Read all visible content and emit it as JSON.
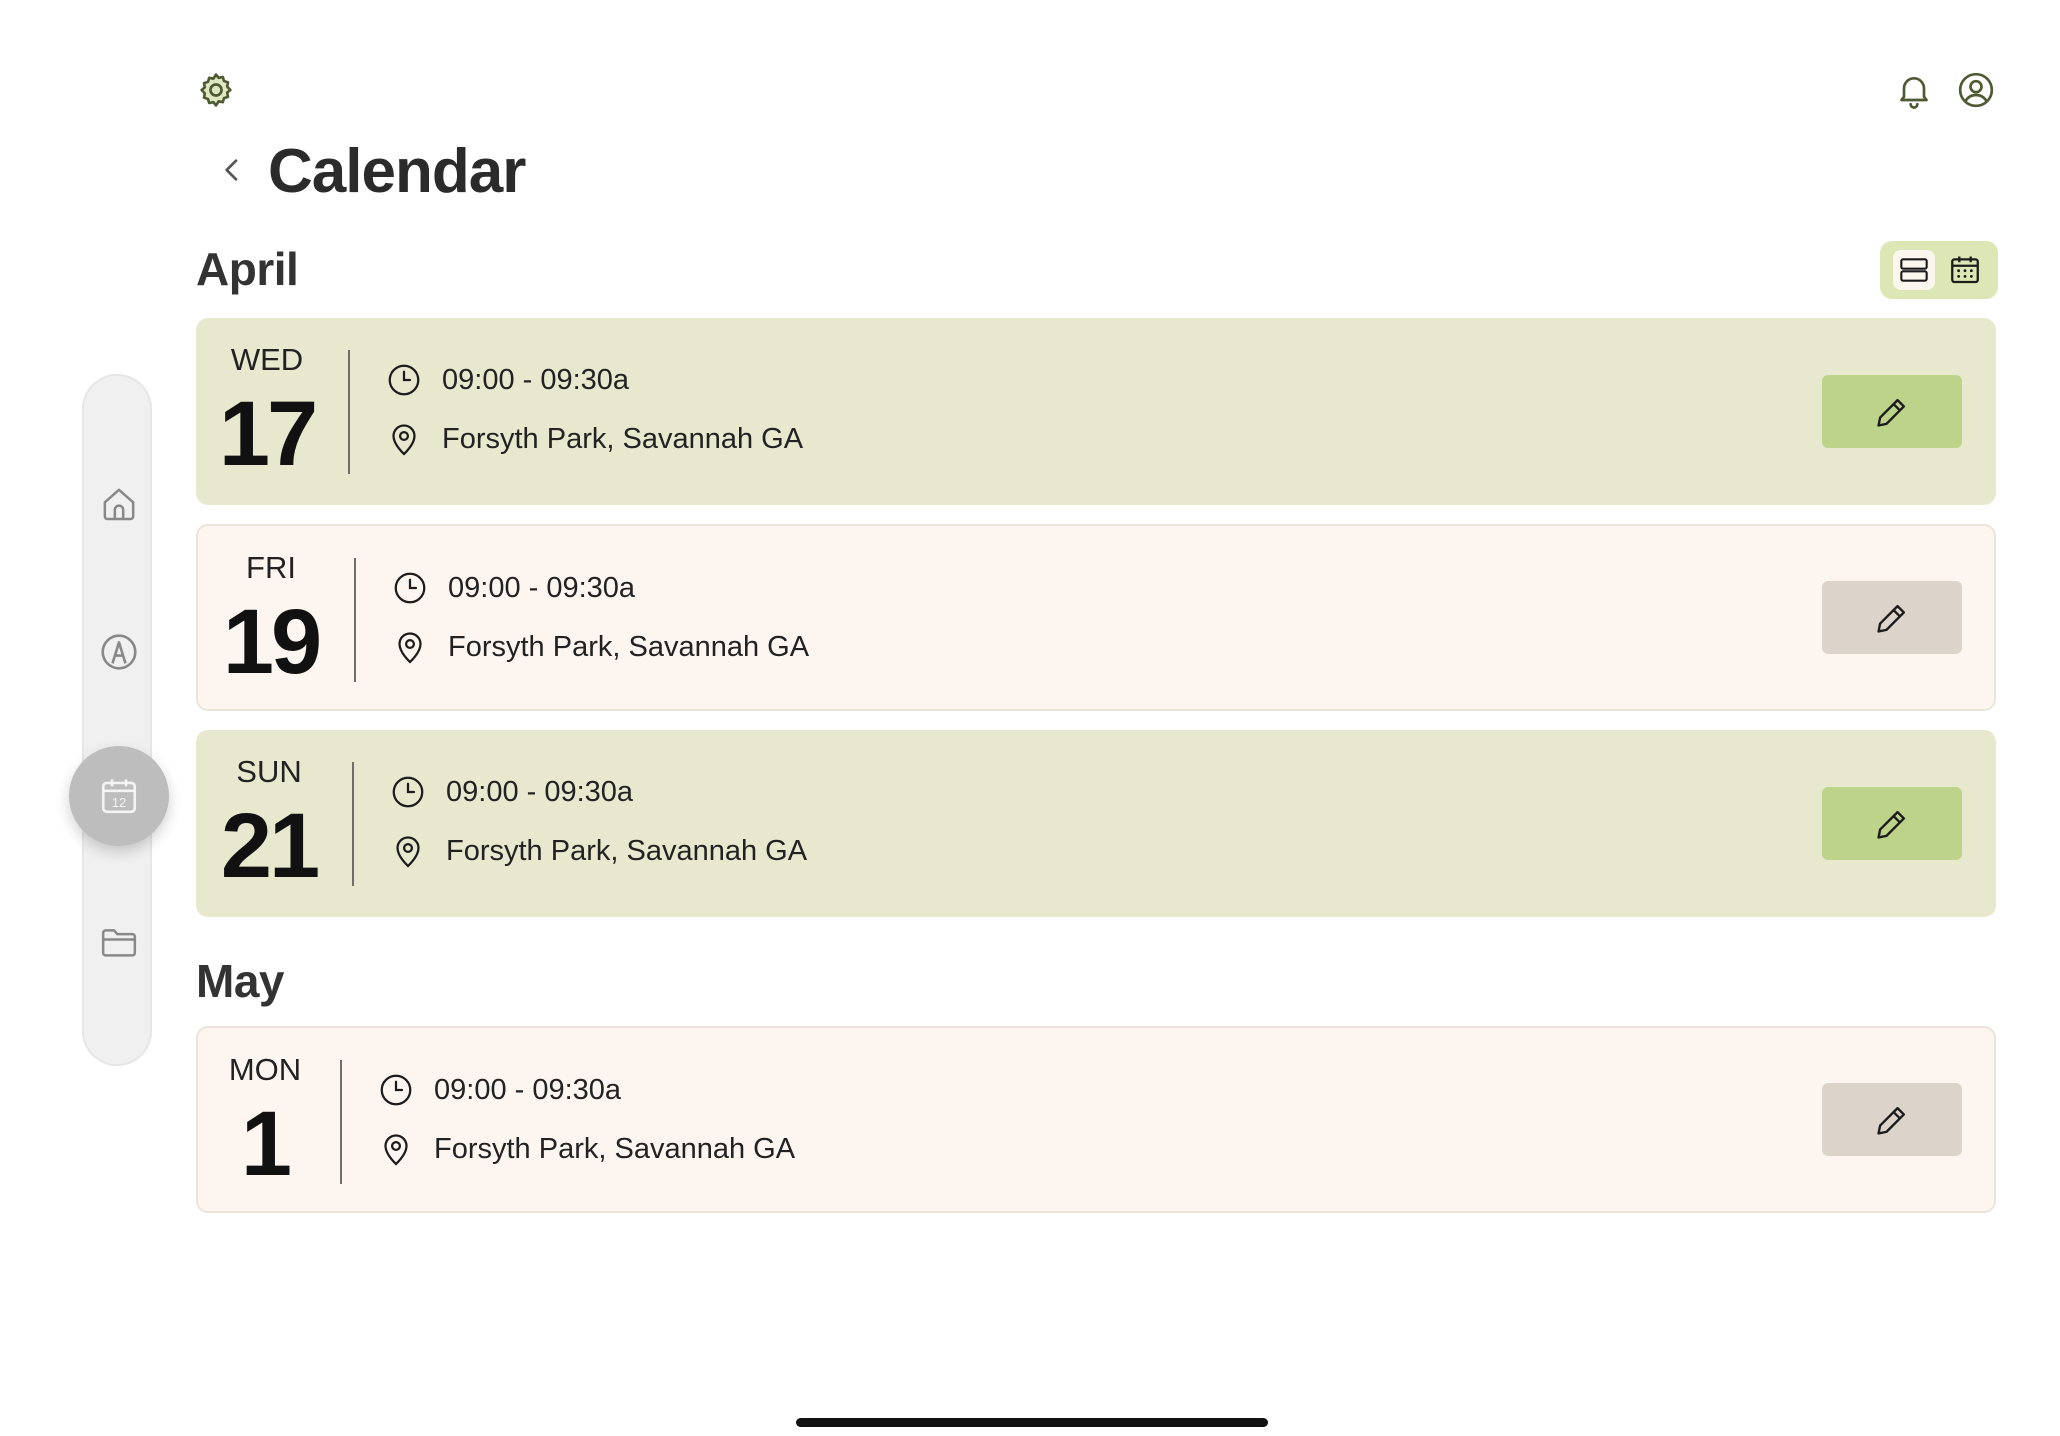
{
  "header": {
    "title": "Calendar"
  },
  "view_toggle": {
    "selected": "list",
    "options": [
      "list-view-icon",
      "calendar-view-icon"
    ]
  },
  "sidebar": {
    "items": [
      {
        "icon": "home-icon"
      },
      {
        "icon": "compass-a-icon"
      },
      {
        "icon": "calendar-12-icon",
        "active": true,
        "badge_text": "12"
      },
      {
        "icon": "folder-icon"
      }
    ]
  },
  "months": [
    {
      "name": "April",
      "events": [
        {
          "dow": "WED",
          "day": "17",
          "time": "09:00 - 09:30a",
          "location": "Forsyth Park, Savannah GA",
          "style": "green"
        },
        {
          "dow": "FRI",
          "day": "19",
          "time": "09:00 - 09:30a",
          "location": "Forsyth Park, Savannah GA",
          "style": "cream"
        },
        {
          "dow": "SUN",
          "day": "21",
          "time": "09:00 - 09:30a",
          "location": "Forsyth Park, Savannah GA",
          "style": "green"
        }
      ]
    },
    {
      "name": "May",
      "events": [
        {
          "dow": "MON",
          "day": "1",
          "time": "09:00 - 09:30a",
          "location": "Forsyth Park, Savannah GA",
          "style": "cream"
        }
      ]
    }
  ],
  "colors": {
    "green_card": "#e7e8cd",
    "cream_card": "#fdf6f0",
    "green_button": "#bdd38a",
    "gray_button": "#dcd4cb",
    "accent": "#dde7b6"
  }
}
